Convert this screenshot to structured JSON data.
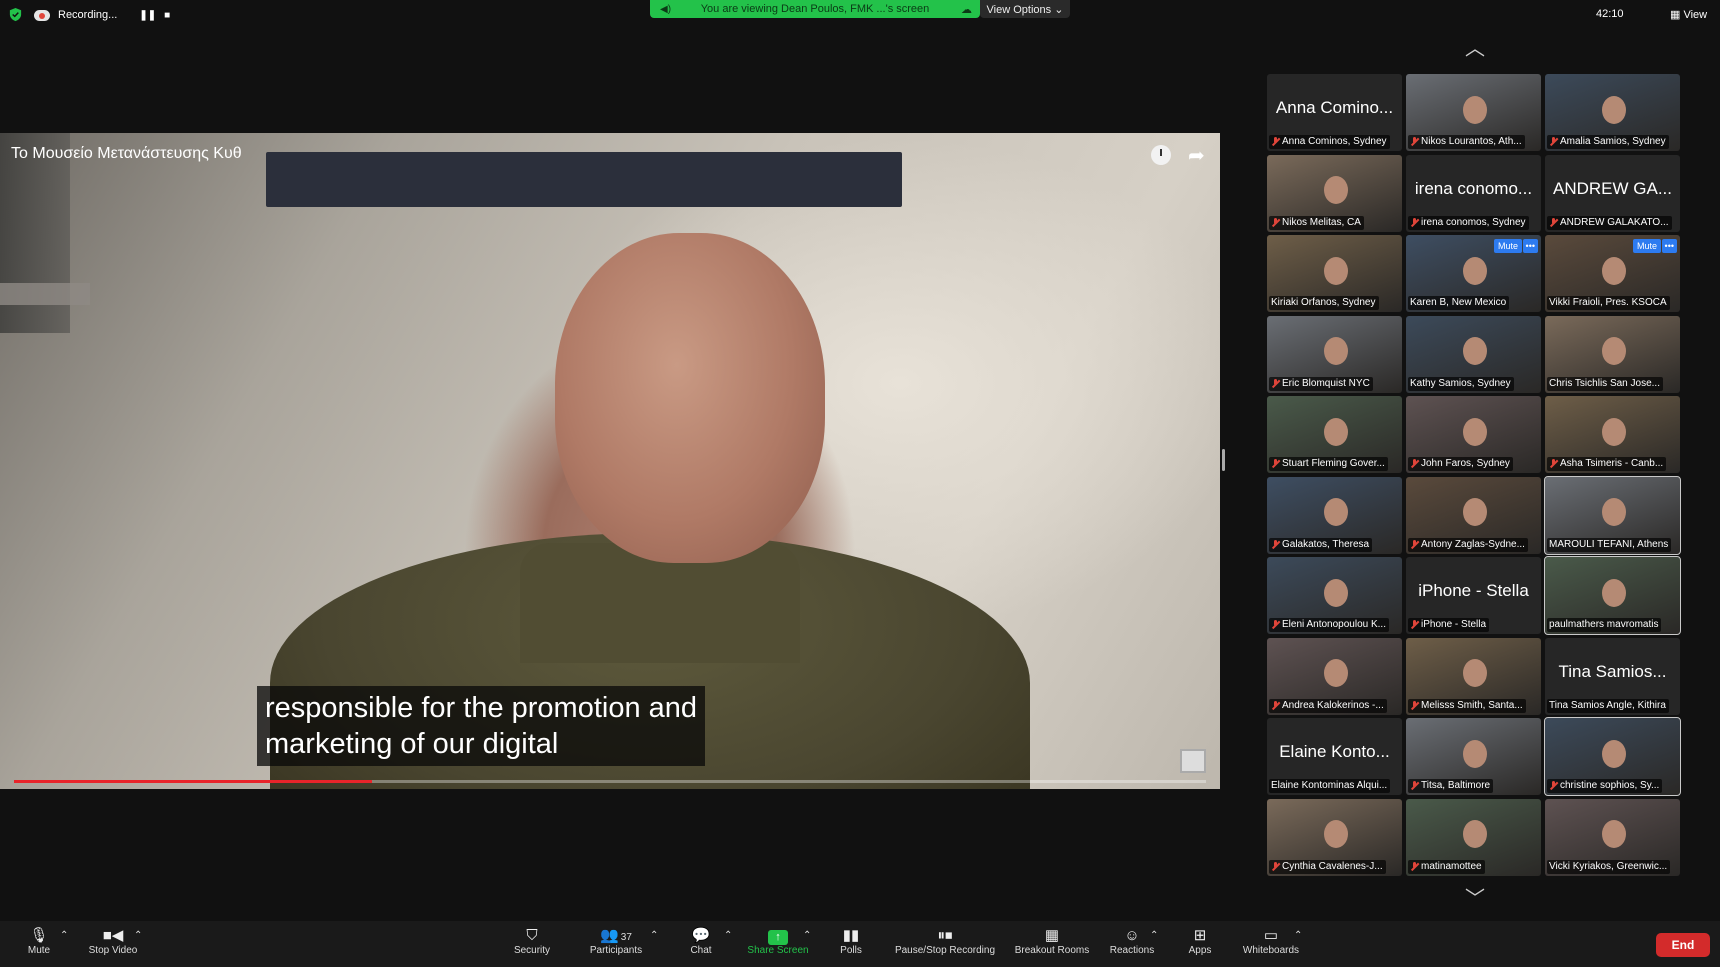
{
  "top": {
    "recording_label": "Recording...",
    "pause_symbol": "❚❚",
    "stop_symbol": "■",
    "viewing_banner": "You are viewing Dean Poulos, FMK ...'s screen",
    "view_options": "View Options ⌄",
    "time": "42:10",
    "view_label": "View"
  },
  "video": {
    "title": "Το Μουσείο Μετανάστευσης Κυθ",
    "caption_lines": [
      "responsible for the promotion and",
      "marketing of our digital"
    ],
    "progress_fraction": 0.3
  },
  "participants": [
    {
      "big": "Anna Comino...",
      "label": "Anna Cominos, Sydney",
      "muted": true
    },
    {
      "label": "Nikos Lourantos, Ath...",
      "muted": true,
      "video": true
    },
    {
      "label": "Amalia Samios, Sydney",
      "muted": true,
      "video": true
    },
    {
      "label": "Nikos Melitas, CA",
      "muted": true,
      "video": true
    },
    {
      "big": "irena conomo...",
      "label": "irena conomos, Sydney",
      "muted": true
    },
    {
      "big": "ANDREW GA...",
      "label": "ANDREW GALAKATO...",
      "muted": true
    },
    {
      "label": "Kiriaki Orfanos, Sydney",
      "muted": false,
      "video": true
    },
    {
      "label": "Karen B, New Mexico",
      "muted": false,
      "video": true,
      "mute_btn": "Mute",
      "more": "•••"
    },
    {
      "label": "Vikki Fraioli, Pres. KSOCA",
      "muted": false,
      "video": true,
      "mute_btn": "Mute",
      "more": "•••"
    },
    {
      "label": "Eric Blomquist NYC",
      "muted": true,
      "video": true
    },
    {
      "label": "Kathy Samios, Sydney",
      "muted": false,
      "video": true
    },
    {
      "label": "Chris Tsichlis San Jose...",
      "muted": false,
      "video": true
    },
    {
      "label": "Stuart Fleming Gover...",
      "muted": true,
      "video": true
    },
    {
      "label": "John Faros, Sydney",
      "muted": true,
      "video": true
    },
    {
      "label": "Asha Tsimeris - Canb...",
      "muted": true,
      "video": true
    },
    {
      "label": "Galakatos, Theresa",
      "muted": true,
      "video": true
    },
    {
      "label": "Antony Zaglas-Sydne...",
      "muted": true,
      "video": true
    },
    {
      "label": "MAROULI TEFANI, Athens",
      "muted": false,
      "video": true
    },
    {
      "label": "Eleni Antonopoulou K...",
      "muted": true,
      "video": true
    },
    {
      "big": "iPhone - Stella",
      "label": "iPhone - Stella",
      "muted": true
    },
    {
      "label": "paulmathers mavromatis",
      "muted": false,
      "video": true
    },
    {
      "label": "Andrea Kalokerinos -...",
      "muted": true,
      "video": true
    },
    {
      "label": "Melisss Smith, Santa...",
      "muted": true,
      "video": true
    },
    {
      "big": "Tina Samios...",
      "label": "Tina Samios Angle, Kithira",
      "muted": false
    },
    {
      "big": "Elaine Konto...",
      "label": "Elaine Kontominas Alqui...",
      "muted": false
    },
    {
      "label": "Titsa, Baltimore",
      "muted": true,
      "video": true
    },
    {
      "label": "christine sophios, Sy...",
      "muted": true,
      "video": true
    },
    {
      "label": "Cynthia Cavalenes-J...",
      "muted": true,
      "video": true
    },
    {
      "label": "matinamottee",
      "muted": true,
      "video": true
    },
    {
      "label": "Vicki Kyriakos, Greenwic...",
      "muted": false,
      "video": true
    }
  ],
  "toolbar": {
    "mute": "Mute",
    "stop_video": "Stop Video",
    "security": "Security",
    "participants": "Participants",
    "participants_count": "37",
    "chat": "Chat",
    "share_screen": "Share Screen",
    "polls": "Polls",
    "pause_stop_recording": "Pause/Stop Recording",
    "breakout_rooms": "Breakout Rooms",
    "reactions": "Reactions",
    "apps": "Apps",
    "whiteboards": "Whiteboards",
    "end": "End"
  },
  "icons": {
    "security": "shield-icon",
    "mic": "microphone-icon",
    "camera": "camera-icon",
    "participants": "people-icon",
    "chat": "chat-bubble-icon",
    "share": "share-screen-icon",
    "polls": "bar-chart-icon",
    "recording": "pause-stop-icon",
    "breakout": "grid-icon",
    "reactions": "smiley-icon",
    "apps": "apps-icon",
    "whiteboards": "whiteboard-icon"
  },
  "colors": {
    "banner_green": "#23c24a",
    "end_red": "#d32b2b",
    "progress_red": "#e8242a",
    "mute_blue": "#2d7bf0"
  }
}
